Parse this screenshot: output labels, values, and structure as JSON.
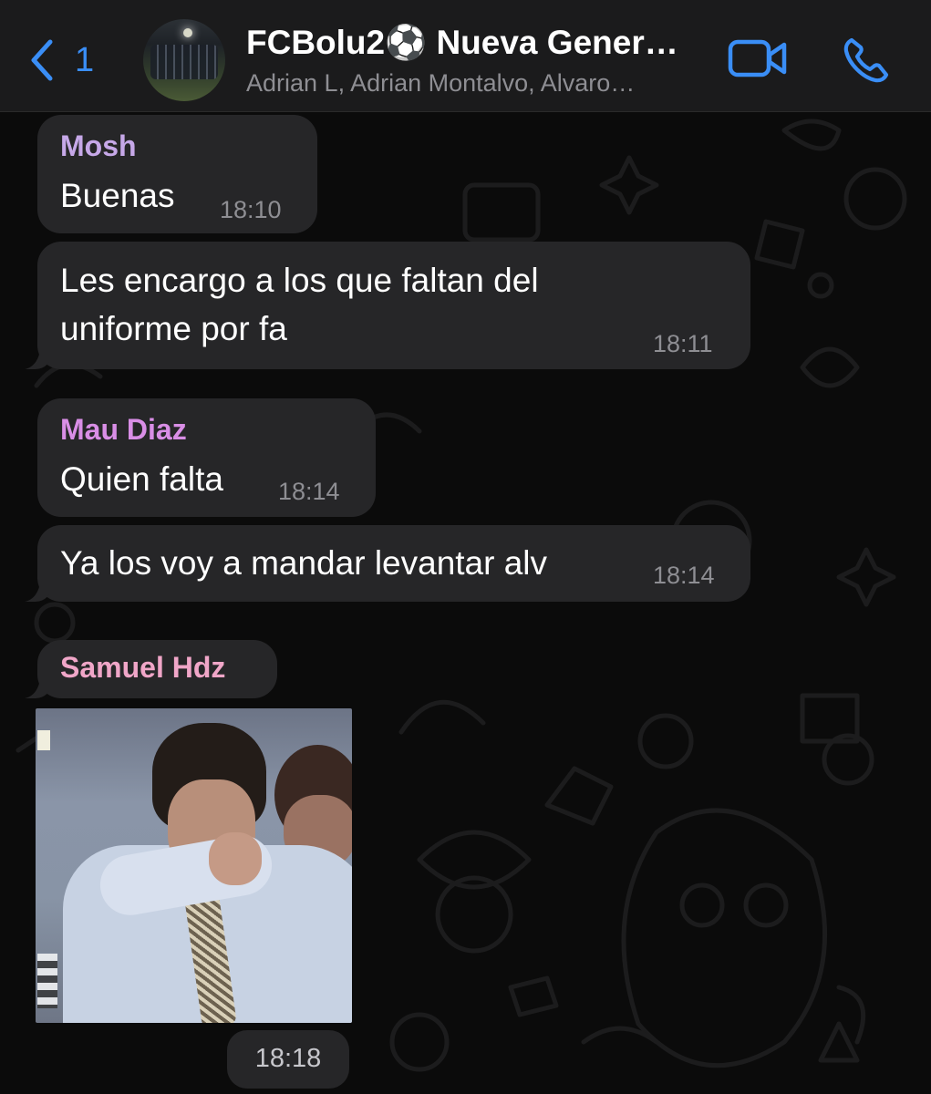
{
  "header": {
    "back_count": "1",
    "title": "FCBolu2⚽️ Nueva Gener…",
    "subtitle": "Adrian L, Adrian Montalvo, Alvaro…",
    "accent_color": "#3a8ef6",
    "icons": [
      "chevron-left-icon",
      "video-camera-icon",
      "phone-icon"
    ]
  },
  "messages": [
    {
      "sender": "Mosh",
      "sender_color": "#c6a8e8",
      "text": "Buenas",
      "time": "18:10"
    },
    {
      "text_line1": "Les encargo a los que faltan del",
      "text_line2": "uniforme por fa",
      "time": "18:11"
    },
    {
      "sender": "Mau Diaz",
      "sender_color": "#d98ee6",
      "text": "Quien falta",
      "time": "18:14"
    },
    {
      "text": "Ya los voy a mandar levantar alv",
      "time": "18:14"
    },
    {
      "sender": "Samuel Hdz",
      "sender_color": "#f0a6c8",
      "time": "18:18"
    }
  ]
}
